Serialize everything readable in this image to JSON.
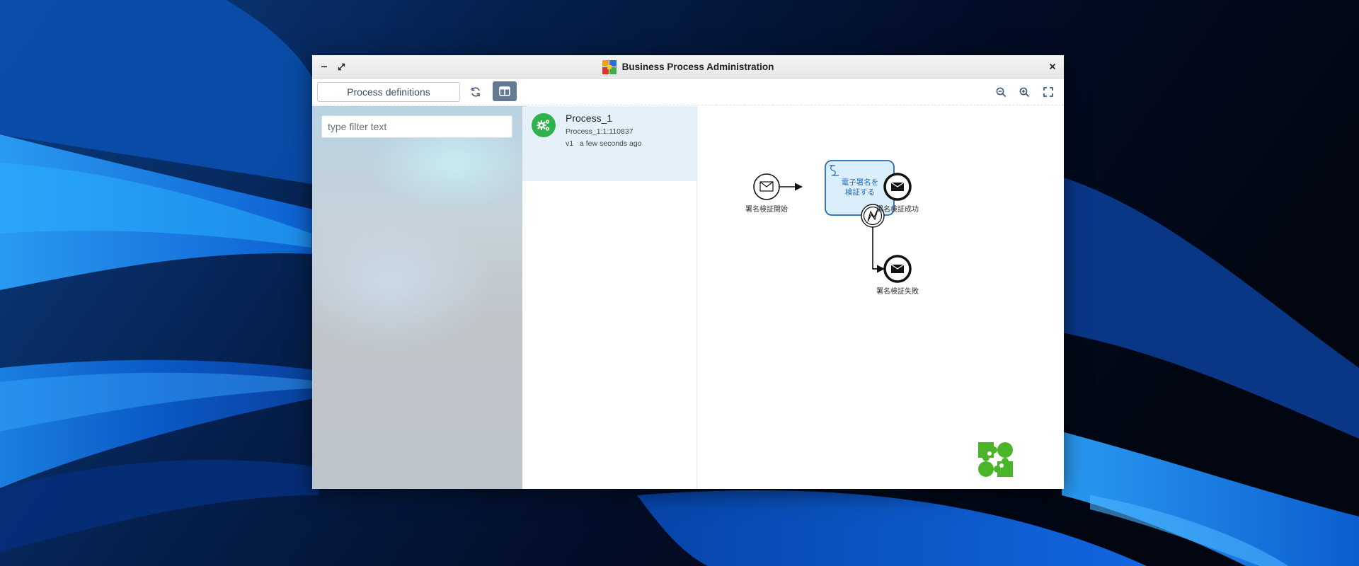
{
  "window": {
    "title": "Business Process Administration",
    "minimize_label": "–",
    "close_label": "×"
  },
  "toolbar": {
    "view_selector": "Process definitions"
  },
  "filter": {
    "placeholder": "type filter text",
    "value": ""
  },
  "processes": [
    {
      "name": "Process_1",
      "id": "Process_1:1:110837",
      "version": "v1",
      "deployed": "a few seconds ago"
    }
  ],
  "diagram": {
    "start_event_label": "署名検証開始",
    "task_label_line1": "電子署名を",
    "task_label_line2": "検証する",
    "end_success_label": "署名検証成功",
    "end_failure_label": "署名検証失敗"
  },
  "colors": {
    "accent_green": "#2fb14c",
    "task_blue": "#1f6db4",
    "task_fill": "#dbeefb",
    "layout_button": "#647a92",
    "selected_row": "#e6f0f8"
  }
}
